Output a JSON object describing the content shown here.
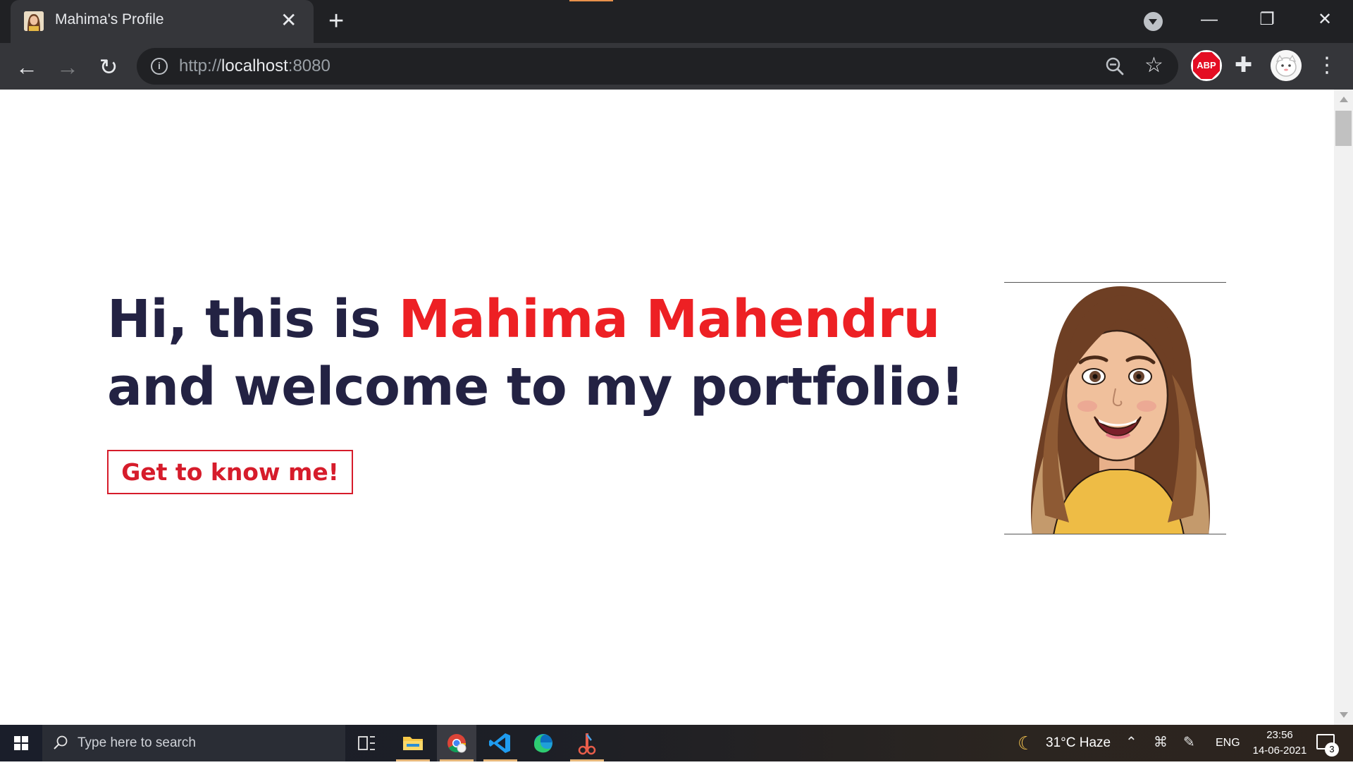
{
  "browser": {
    "tab": {
      "title": "Mahima's Profile",
      "close_glyph": "✕"
    },
    "new_tab_glyph": "+",
    "window_controls": {
      "minimize": "—",
      "maximize": "❐",
      "close": "✕"
    },
    "nav": {
      "back": "←",
      "forward": "→",
      "reload": "↻"
    },
    "omnibox": {
      "scheme": "http://",
      "host": "localhost",
      "port": ":8080",
      "info_glyph": "i"
    },
    "star_glyph": "☆",
    "extensions": {
      "abp_label": "ABP",
      "puzzle_glyph": "✚"
    },
    "menu_glyph": "⋮"
  },
  "page": {
    "heading_prefix": "Hi, this is ",
    "heading_name": "Mahima Mahendru",
    "heading_suffix": "and welcome to my portfolio!",
    "cta_label": "Get to know me!",
    "colors": {
      "heading": "#232243",
      "accent": "#ed2024",
      "cta": "#d61c2b"
    }
  },
  "taskbar": {
    "search_placeholder": "Type here to search",
    "weather": {
      "icon": "moon-icon",
      "text": "31°C  Haze"
    },
    "tray_chevron": "⌃",
    "language": "ENG",
    "time": "23:56",
    "date": "14-06-2021",
    "notification_count": "3"
  }
}
